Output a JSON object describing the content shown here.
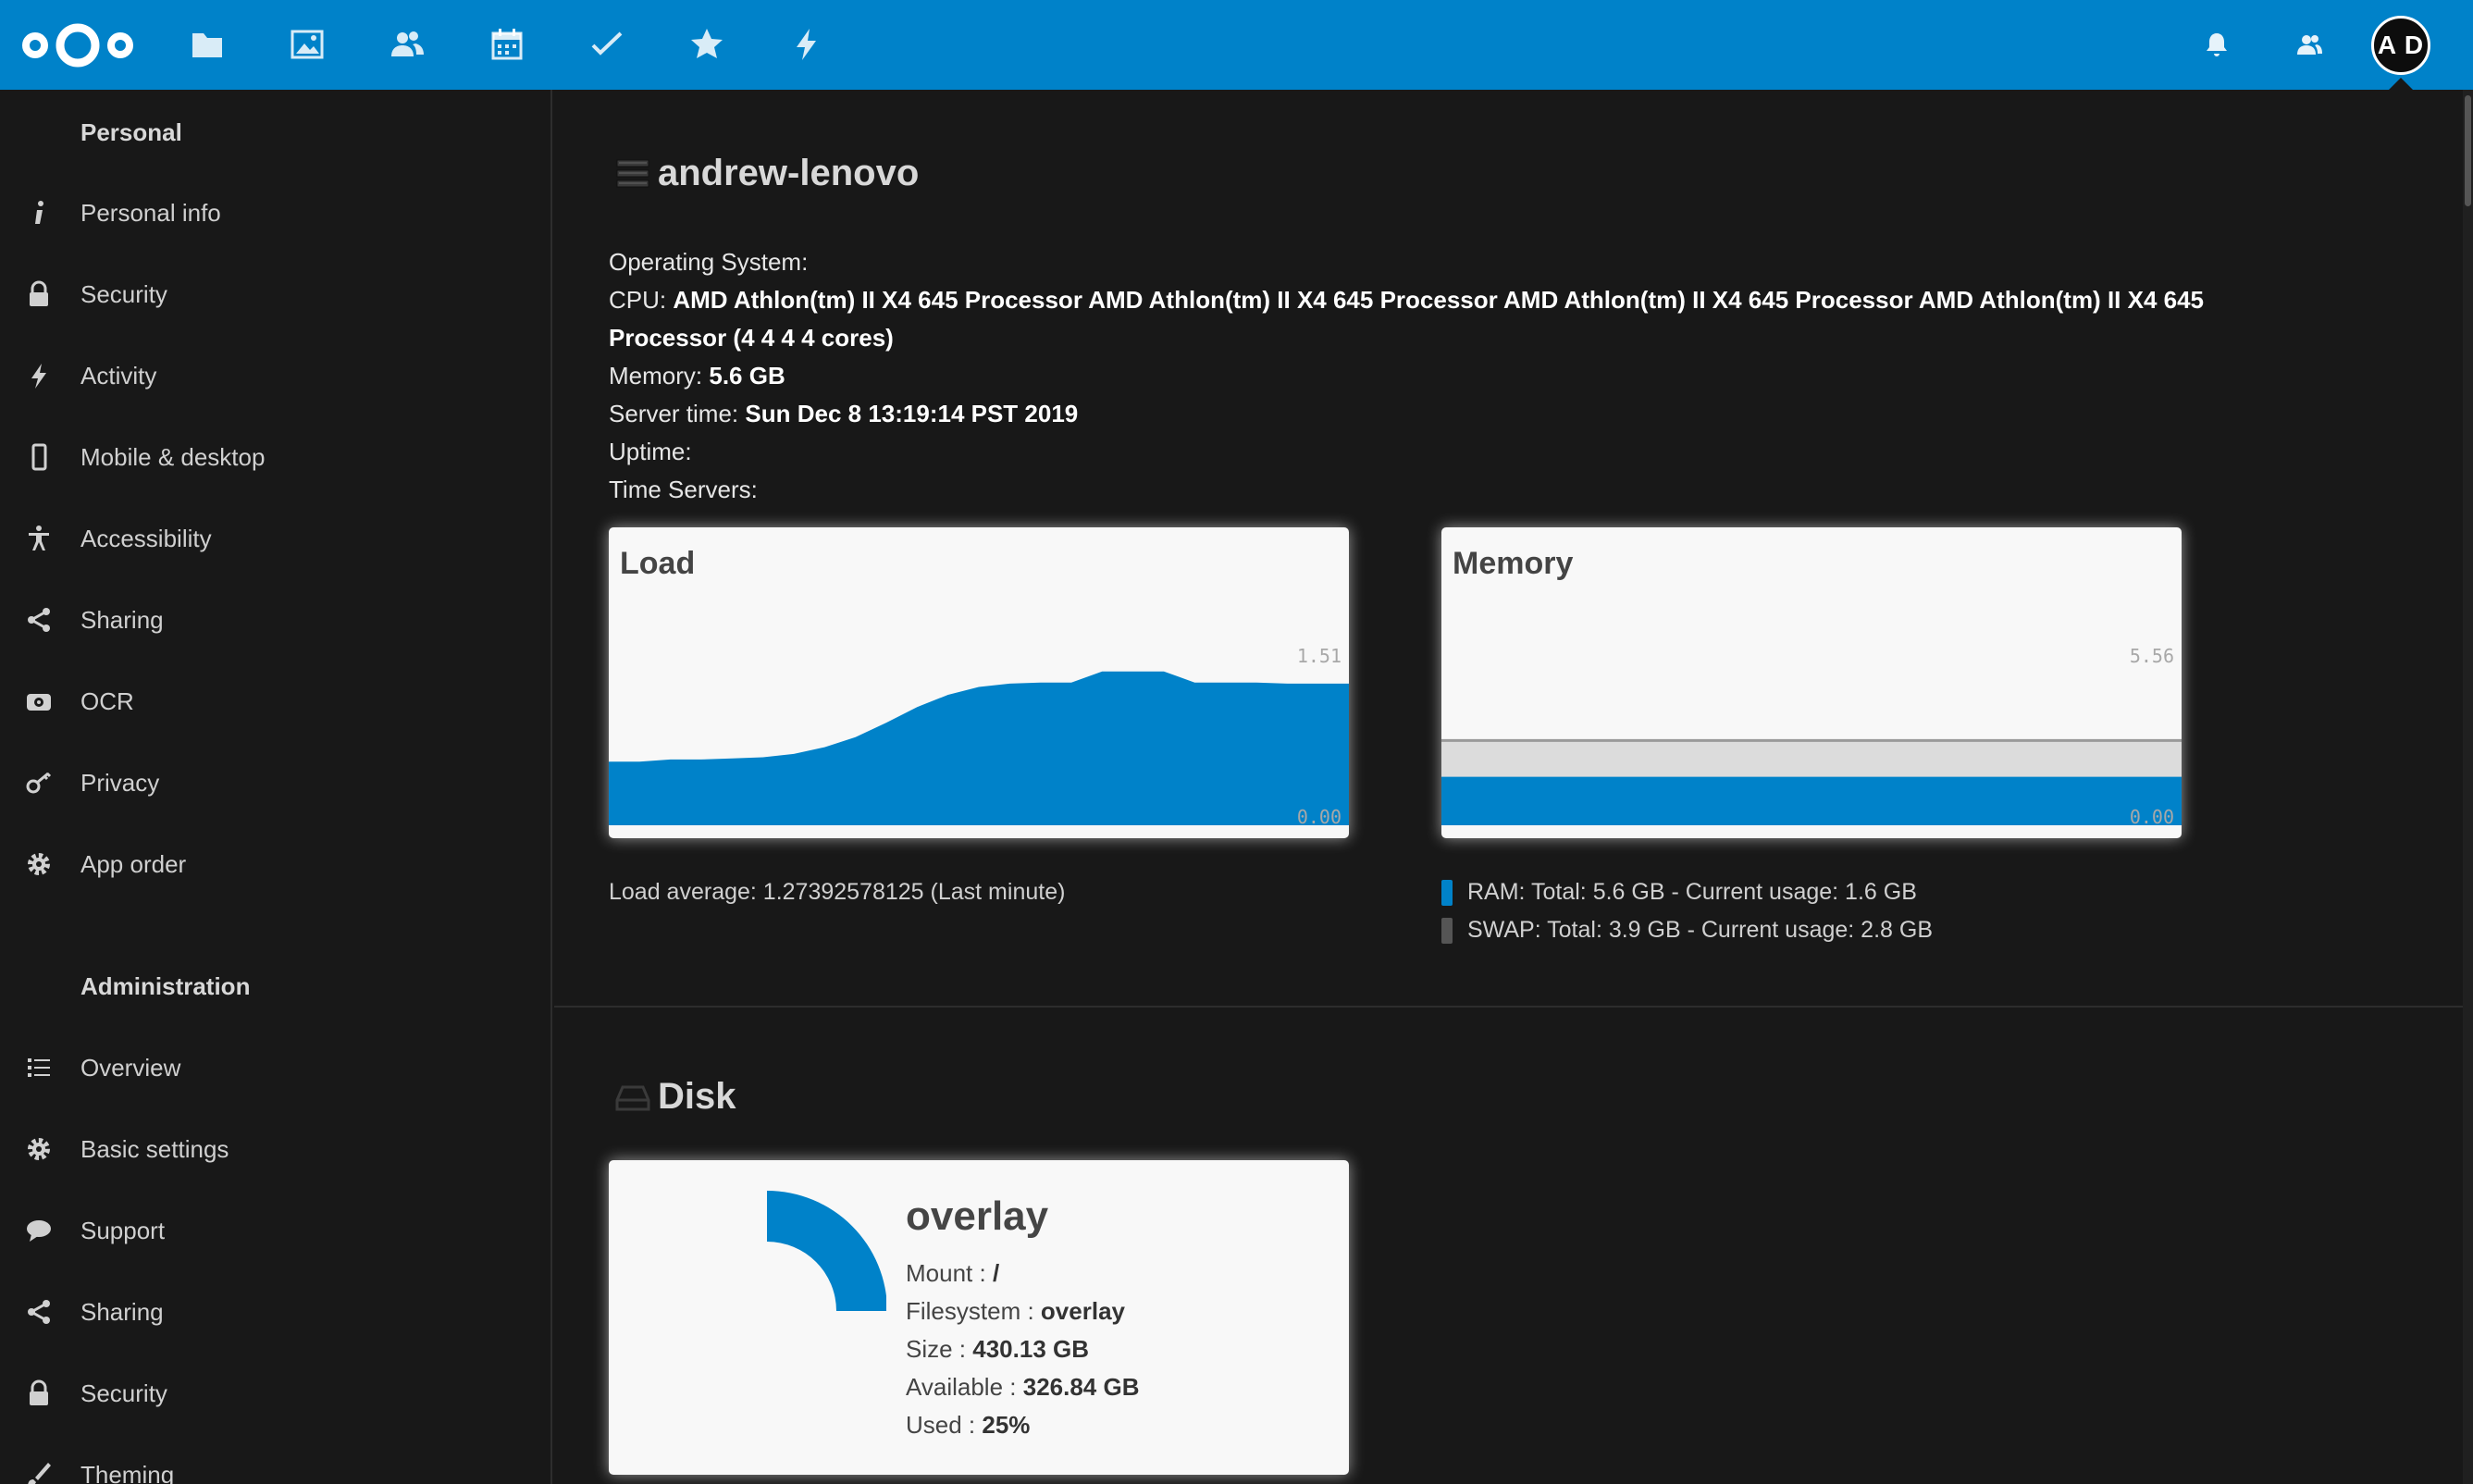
{
  "header": {
    "apps": [
      {
        "name": "files-icon"
      },
      {
        "name": "photos-icon"
      },
      {
        "name": "contacts-icon"
      },
      {
        "name": "calendar-icon"
      },
      {
        "name": "tasks-icon"
      },
      {
        "name": "favorites-icon"
      },
      {
        "name": "activity-icon"
      }
    ],
    "avatar_initials": "A D",
    "brand_color": "#0082c9"
  },
  "sidebar": {
    "personal_title": "Personal",
    "personal": [
      {
        "label": "Personal info",
        "icon": "info-icon"
      },
      {
        "label": "Security",
        "icon": "lock-icon"
      },
      {
        "label": "Activity",
        "icon": "lightning-icon"
      },
      {
        "label": "Mobile & desktop",
        "icon": "phone-icon"
      },
      {
        "label": "Accessibility",
        "icon": "accessibility-icon"
      },
      {
        "label": "Sharing",
        "icon": "share-icon"
      },
      {
        "label": "OCR",
        "icon": "camera-icon"
      },
      {
        "label": "Privacy",
        "icon": "key-icon"
      },
      {
        "label": "App order",
        "icon": "gear-icon"
      }
    ],
    "admin_title": "Administration",
    "admin": [
      {
        "label": "Overview",
        "icon": "list-icon"
      },
      {
        "label": "Basic settings",
        "icon": "gear-icon"
      },
      {
        "label": "Support",
        "icon": "comment-icon"
      },
      {
        "label": "Sharing",
        "icon": "share-icon"
      },
      {
        "label": "Security",
        "icon": "lock-icon"
      },
      {
        "label": "Theming",
        "icon": "brush-icon"
      }
    ]
  },
  "system": {
    "hostname": "andrew-lenovo",
    "os_label": "Operating System:",
    "cpu_label": "CPU:",
    "cpu_value_line1": "AMD Athlon(tm) II X4 645 Processor AMD Athlon(tm) II X4 645 Processor AMD Athlon(tm) II X4 645 Processor AMD Athlon(tm) II X4 645",
    "cpu_value_line2": "Processor (4 4 4 4 cores)",
    "memory_label": "Memory:",
    "memory_value": "5.6 GB",
    "server_time_label": "Server time:",
    "server_time_value": "Sun Dec 8 13:19:14 PST 2019",
    "uptime_label": "Uptime:",
    "time_servers_label": "Time Servers:"
  },
  "load_card": {
    "title": "Load",
    "max_label": "1.51",
    "min_label": "0.00",
    "caption": "Load average: 1.27392578125 (Last minute)"
  },
  "memory_card": {
    "title": "Memory",
    "max_label": "5.56",
    "min_label": "0.00",
    "ram_legend": "RAM: Total: 5.6 GB - Current usage: 1.6 GB",
    "swap_legend": "SWAP: Total: 3.9 GB - Current usage: 2.8 GB",
    "ram_color": "#0082c9",
    "swap_color": "#555555"
  },
  "disk": {
    "section_title": "Disk",
    "name": "overlay",
    "mount_label": "Mount :",
    "mount_value": "/",
    "fs_label": "Filesystem :",
    "fs_value": "overlay",
    "size_label": "Size :",
    "size_value": "430.13 GB",
    "available_label": "Available :",
    "available_value": "326.84 GB",
    "used_label": "Used :",
    "used_value": "25%",
    "used_fraction": 0.25
  },
  "chart_data": [
    {
      "type": "area",
      "title": "Load",
      "ylim": [
        0,
        1.51
      ],
      "series": [
        {
          "values": [
            0.57,
            0.57,
            0.59,
            0.59,
            0.6,
            0.61,
            0.64,
            0.7,
            0.79,
            0.92,
            1.06,
            1.17,
            1.24,
            1.27,
            1.28,
            1.28,
            1.38,
            1.38,
            1.38,
            1.28,
            1.28,
            1.28,
            1.27,
            1.27,
            1.27
          ]
        }
      ]
    },
    {
      "type": "area",
      "title": "Memory",
      "ylim": [
        0,
        5.56
      ],
      "series": [
        {
          "name": "RAM",
          "values": [
            1.6,
            1.6,
            1.6,
            1.6,
            1.6,
            1.6,
            1.6,
            1.6,
            1.6,
            1.6,
            1.6,
            1.6,
            1.6,
            1.6,
            1.6
          ]
        },
        {
          "name": "SWAP",
          "values": [
            2.8,
            2.8,
            2.8,
            2.8,
            2.8,
            2.8,
            2.8,
            2.8,
            2.8,
            2.8,
            2.8,
            2.8,
            2.8,
            2.8,
            2.8
          ]
        }
      ]
    },
    {
      "type": "pie",
      "title": "overlay",
      "values": [
        25,
        75
      ]
    }
  ]
}
